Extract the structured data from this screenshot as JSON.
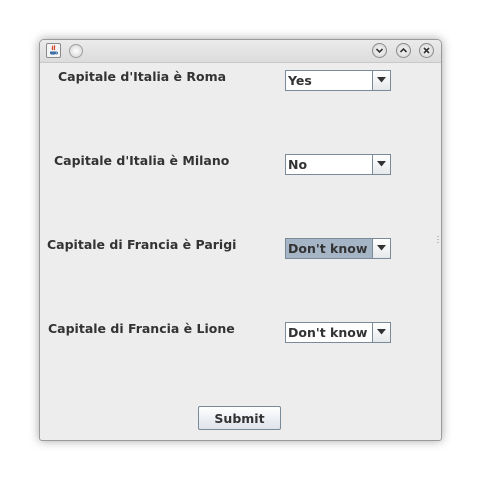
{
  "window": {
    "controls": {
      "app_icon": "java-icon",
      "menu_icon": "window-menu-icon",
      "minimize_icon": "chevron-down-icon",
      "maximize_icon": "chevron-up-icon",
      "close_icon": "close-icon"
    }
  },
  "questions": [
    {
      "label": "Capitale d'Italia è Roma",
      "answer": "Yes"
    },
    {
      "label": "Capitale d'Italia è Milano",
      "answer": "No"
    },
    {
      "label": "Capitale di Francia è Parigi",
      "answer": "Don't know",
      "focused": true
    },
    {
      "label": "Capitale di Francia è Lione",
      "answer": "Don't know"
    }
  ],
  "submit_label": "Submit",
  "colors": {
    "window_bg": "#ededed",
    "focused_combo_bg": "#a6b5c6",
    "text": "#333333"
  }
}
